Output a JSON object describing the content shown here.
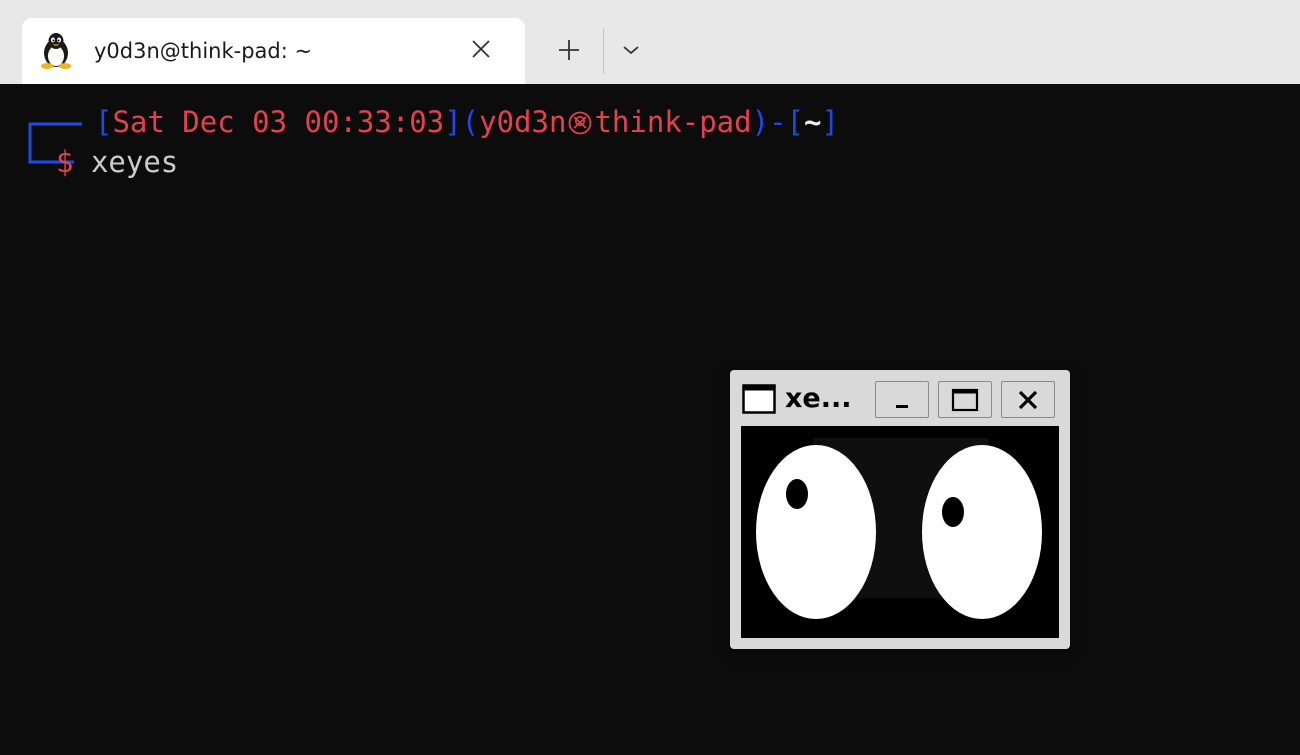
{
  "tab": {
    "icon": "linux-tux-icon",
    "title": "y0d3n@think-pad: ~",
    "close_icon": "close-icon"
  },
  "tabbar": {
    "new_tab_icon": "plus-icon",
    "dropdown_icon": "chevron-down-icon"
  },
  "terminal": {
    "prompt": {
      "open_bracket": "[",
      "datetime": "Sat Dec 03 00:33:03",
      "close_bracket": "]",
      "paren_open": "(",
      "user": "y0d3n",
      "skull_icon": "skull-icon",
      "host": "think-pad",
      "paren_close": ")",
      "dash": "-",
      "dir_open": "[",
      "dir": "~",
      "dir_close": "]",
      "dollar": "$",
      "command": "xeyes"
    }
  },
  "xeyes_window": {
    "title": "xe...",
    "app_icon": "window-icon",
    "minimize_icon": "minimize-icon",
    "maximize_icon": "maximize-icon",
    "close_icon": "close-icon"
  },
  "colors": {
    "tab_bar_bg": "#e8e8e8",
    "tab_bg": "#ffffff",
    "terminal_bg": "#0c0c0c",
    "prompt_blue": "#1b4be6",
    "prompt_red": "#e3414e",
    "command_text": "#cccccc",
    "xwin_frame": "#d9d9d9"
  }
}
